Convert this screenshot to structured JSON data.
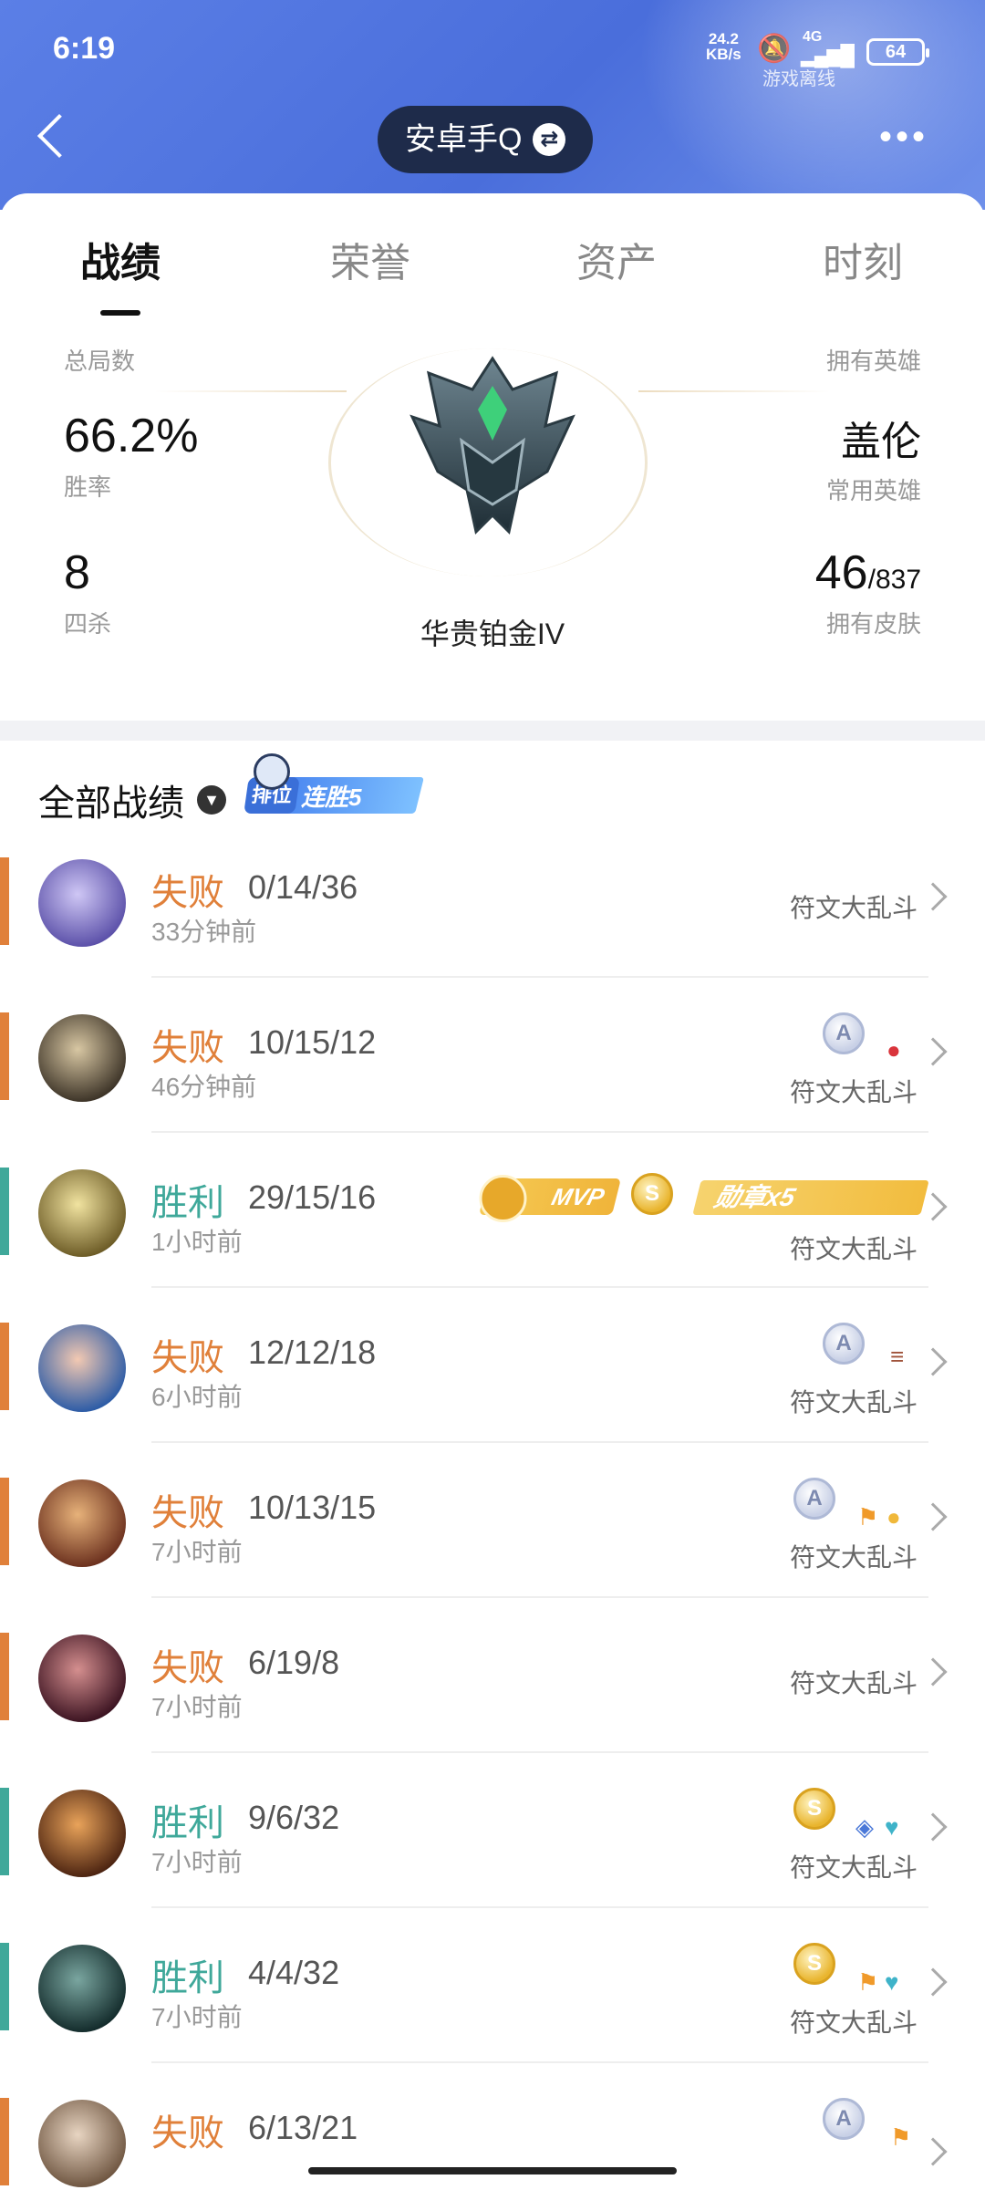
{
  "status_bar": {
    "time": "6:19",
    "net_speed": "24.2",
    "net_unit": "KB/s",
    "signal": "4G",
    "battery": "64",
    "offline_label": "游戏离线"
  },
  "header": {
    "account_name": "安卓手Q",
    "swap_icon": "swap-icon",
    "more_icon": "more-icon",
    "back_icon": "back-icon"
  },
  "tabs": [
    {
      "label": "战绩",
      "active": true
    },
    {
      "label": "荣誉"
    },
    {
      "label": "资产"
    },
    {
      "label": "时刻"
    }
  ],
  "stats": {
    "total_games_label": "总局数",
    "owned_heroes_label": "拥有英雄",
    "win_rate": "66.2%",
    "win_rate_label": "胜率",
    "main_hero": "盖伦",
    "main_hero_label": "常用英雄",
    "quadra_kills": "8",
    "quadra_kills_label": "四杀",
    "skins_owned": "46",
    "skins_total": "/837",
    "skins_label": "拥有皮肤",
    "rank_name": "华贵铂金IV",
    "rank_stars_filled": 1,
    "rank_stars_total": 4
  },
  "section": {
    "title": "全部战绩",
    "streak_tag": "排位",
    "streak_label": "连胜5"
  },
  "colors": {
    "lose": "#e0803a",
    "win": "#3fa89a",
    "header": "#4a6edb"
  },
  "matches": [
    {
      "result": "失败",
      "kda": "0/14/36",
      "ago": "33分钟前",
      "mode": "符文大乱斗",
      "win": false
    },
    {
      "result": "失败",
      "kda": "10/15/12",
      "ago": "46分钟前",
      "mode": "符文大乱斗",
      "win": false
    },
    {
      "result": "胜利",
      "kda": "29/15/16",
      "ago": "1小时前",
      "mode": "符文大乱斗",
      "win": true,
      "mvp_label": "MVP",
      "medal_label": "勋章x5"
    },
    {
      "result": "失败",
      "kda": "12/12/18",
      "ago": "6小时前",
      "mode": "符文大乱斗",
      "win": false
    },
    {
      "result": "失败",
      "kda": "10/13/15",
      "ago": "7小时前",
      "mode": "符文大乱斗",
      "win": false
    },
    {
      "result": "失败",
      "kda": "6/19/8",
      "ago": "7小时前",
      "mode": "符文大乱斗",
      "win": false
    },
    {
      "result": "胜利",
      "kda": "9/6/32",
      "ago": "7小时前",
      "mode": "符文大乱斗",
      "win": true
    },
    {
      "result": "胜利",
      "kda": "4/4/32",
      "ago": "7小时前",
      "mode": "符文大乱斗",
      "win": true
    },
    {
      "result": "失败",
      "kda": "6/13/21",
      "ago": "",
      "mode": "",
      "win": false
    }
  ]
}
